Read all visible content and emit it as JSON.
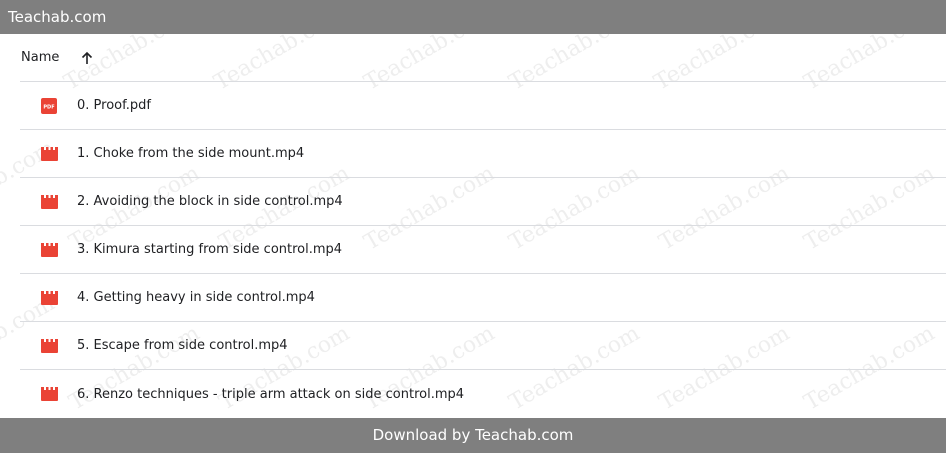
{
  "header": {
    "site_title": "Teachab.com"
  },
  "list_header": {
    "name_label": "Name",
    "sort_icon": "arrow-up-icon"
  },
  "files": [
    {
      "name": "0. Proof.pdf",
      "icon": "pdf-icon"
    },
    {
      "name": "1. Choke from the side mount.mp4",
      "icon": "video-icon"
    },
    {
      "name": "2. Avoiding the block in side control.mp4",
      "icon": "video-icon"
    },
    {
      "name": "3. Kimura starting from side control.mp4",
      "icon": "video-icon"
    },
    {
      "name": "4. Getting heavy in side control.mp4",
      "icon": "video-icon"
    },
    {
      "name": "5. Escape from side control.mp4",
      "icon": "video-icon"
    },
    {
      "name": "6. Renzo techniques - triple arm attack on side control.mp4",
      "icon": "video-icon"
    }
  ],
  "footer": {
    "download_text": "Download by Teachab.com"
  },
  "watermark": {
    "text": "Teachab.com"
  },
  "colors": {
    "bar_gray": "#7f7f7f",
    "icon_red": "#ea4335",
    "divider": "#dadce0"
  }
}
